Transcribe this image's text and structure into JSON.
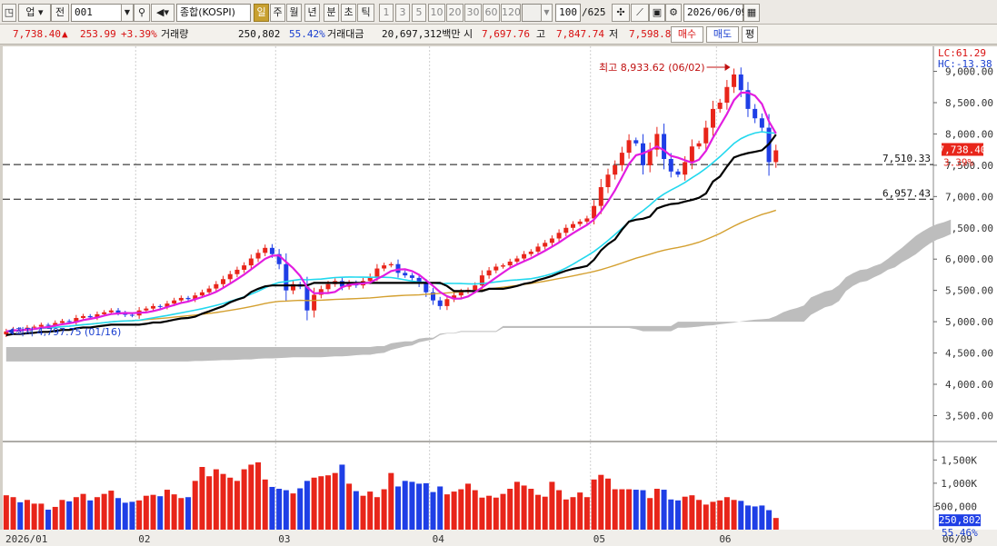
{
  "toolbar": {
    "market_label": "업",
    "market_type": "전",
    "code": "001",
    "name": "종합(KOSPI)",
    "periods": [
      "일",
      "주",
      "월",
      "년",
      "분",
      "초",
      "틱"
    ],
    "selected_period": "일",
    "intervals": [
      "1",
      "3",
      "5",
      "10",
      "20",
      "30",
      "60",
      "120"
    ],
    "count": "100",
    "total": "/625",
    "date": "2026/06/09"
  },
  "quote": {
    "price": "7,738.40",
    "change_arrow": "▲",
    "change": "253.99",
    "change_pct": "+3.39%",
    "volume_label": "거래량",
    "volume": "250,802",
    "volume_ratio": "55.42%",
    "amount_label": "거래대금",
    "amount": "20,697,312백만",
    "open_label": "시",
    "open": "7,697.76",
    "high_label": "고",
    "high": "7,847.74",
    "low_label": "저",
    "low": "7,598.8",
    "buy_label": "매수",
    "sell_label": "매도",
    "eval_label": "평"
  },
  "price_panel": {
    "lc": "LC:61.29",
    "hc": "HC:-13.38",
    "current_price_tag": "7,738.40",
    "current_pct_tag": "3.39%",
    "hline_1": "7,510.33",
    "hline_2": "6,957.43",
    "high_annotation": "최고 8,933.62 (06/02)",
    "low_annotation": "최저 4,797.75 (01/16)"
  },
  "volume_panel": {
    "current_volume_tag": "250,802",
    "current_ratio_tag": "55.46%"
  },
  "colors": {
    "up": "#e8251a",
    "down": "#1f3fe6",
    "ma5": "#e21de0",
    "ma20": "#22d8ee",
    "ma60": "#d4a030",
    "baseline": "#000000",
    "cloud": "#bdbdbd"
  },
  "chart_data": {
    "type": "candlestick",
    "x_axis_labels": [
      "2026/01",
      "02",
      "03",
      "04",
      "05",
      "06",
      "06/09"
    ],
    "y_axis_ticks": [
      "9,000.00",
      "8,500.00",
      "8,000.00",
      "7,500.00",
      "7,000.00",
      "6,500.00",
      "6,000.00",
      "5,500.00",
      "5,000.00",
      "4,500.00",
      "4,000.00",
      "3,500.00"
    ],
    "volume_axis_ticks": [
      "1,500K",
      "1,000K",
      "500,000"
    ],
    "ylim": [
      3100,
      9400
    ],
    "volume_ylim": [
      0,
      1800
    ],
    "month_starts": [
      0,
      19,
      39,
      61,
      84,
      102
    ],
    "close": [
      4845,
      4880,
      4860,
      4905,
      4920,
      4950,
      4935,
      4980,
      5010,
      4995,
      5060,
      5090,
      5070,
      5120,
      5150,
      5180,
      5140,
      5110,
      5100,
      5180,
      5210,
      5250,
      5240,
      5290,
      5340,
      5380,
      5360,
      5420,
      5470,
      5530,
      5600,
      5680,
      5760,
      5830,
      5900,
      6010,
      6100,
      6180,
      6080,
      5920,
      5500,
      5600,
      5560,
      5180,
      5430,
      5520,
      5600,
      5650,
      5560,
      5620,
      5580,
      5650,
      5720,
      5850,
      5900,
      5920,
      5780,
      5740,
      5700,
      5610,
      5470,
      5340,
      5250,
      5360,
      5420,
      5480,
      5510,
      5580,
      5740,
      5820,
      5880,
      5900,
      5960,
      6010,
      6080,
      6120,
      6200,
      6260,
      6330,
      6420,
      6500,
      6560,
      6600,
      6650,
      6850,
      7150,
      7350,
      7500,
      7700,
      7900,
      7850,
      7500,
      7750,
      8000,
      7600,
      7400,
      7350,
      7550,
      7800,
      7850,
      8100,
      8400,
      8500,
      8750,
      8950,
      8700,
      8400,
      8250,
      8100,
      7550,
      7738
    ],
    "volume": [
      740,
      700,
      590,
      640,
      560,
      560,
      430,
      490,
      640,
      610,
      700,
      770,
      630,
      700,
      770,
      840,
      680,
      580,
      600,
      630,
      730,
      750,
      720,
      860,
      760,
      680,
      700,
      1050,
      1350,
      1150,
      1300,
      1200,
      1120,
      1050,
      1300,
      1400,
      1450,
      1080,
      920,
      880,
      850,
      780,
      890,
      1050,
      1120,
      1150,
      1170,
      1220,
      1400,
      990,
      830,
      730,
      820,
      700,
      870,
      1220,
      930,
      1050,
      1030,
      990,
      1000,
      810,
      930,
      760,
      820,
      870,
      990,
      850,
      690,
      730,
      690,
      770,
      880,
      1030,
      950,
      880,
      750,
      710,
      1030,
      850,
      650,
      700,
      800,
      700,
      1080,
      1180,
      1100,
      870,
      870,
      870,
      860,
      850,
      680,
      880,
      860,
      650,
      630,
      710,
      740,
      640,
      540,
      600,
      630,
      700,
      640,
      620,
      520,
      500,
      520,
      420,
      251
    ]
  }
}
